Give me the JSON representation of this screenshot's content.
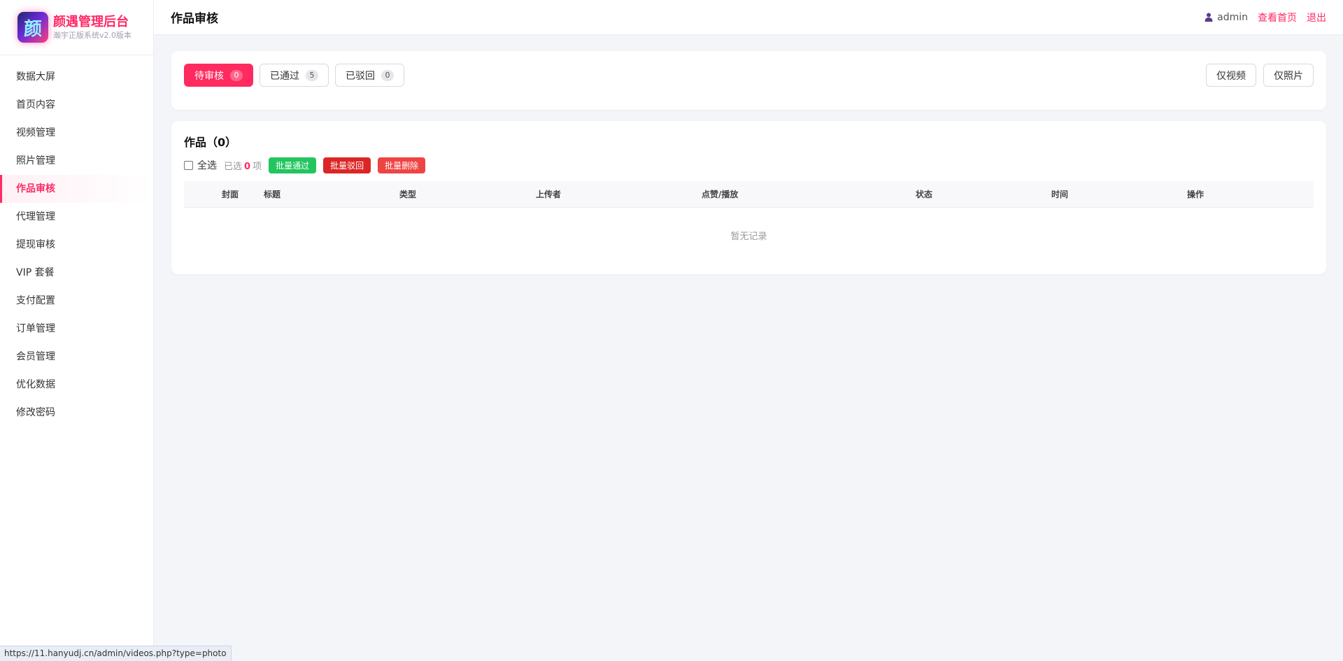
{
  "brand": {
    "logo_char": "颜",
    "title": "颜遇管理后台",
    "subtitle": "瀚宇正版系统v2.0版本"
  },
  "sidebar": {
    "items": [
      {
        "label": "数据大屏"
      },
      {
        "label": "首页内容"
      },
      {
        "label": "视频管理"
      },
      {
        "label": "照片管理"
      },
      {
        "label": "作品审核",
        "active": true
      },
      {
        "label": "代理管理"
      },
      {
        "label": "提现审核"
      },
      {
        "label": "VIP 套餐"
      },
      {
        "label": "支付配置"
      },
      {
        "label": "订单管理"
      },
      {
        "label": "会员管理"
      },
      {
        "label": "优化数据"
      },
      {
        "label": "修改密码"
      }
    ]
  },
  "header": {
    "title": "作品审核",
    "user": "admin",
    "view_home": "查看首页",
    "logout": "退出"
  },
  "filter": {
    "tabs": [
      {
        "label": "待审核",
        "count": "0",
        "active": true
      },
      {
        "label": "已通过",
        "count": "5"
      },
      {
        "label": "已驳回",
        "count": "0"
      }
    ],
    "video_only": "仅视频",
    "photo_only": "仅照片"
  },
  "list": {
    "title": "作品（0）",
    "select_all": "全选",
    "selected_prefix": "已选",
    "selected_count": "0",
    "selected_suffix": "项",
    "batch_approve": "批量通过",
    "batch_reject": "批量驳回",
    "batch_delete": "批量删除",
    "columns": [
      "封面",
      "标题",
      "类型",
      "上传者",
      "点赞/播放",
      "状态",
      "时间",
      "操作"
    ],
    "empty_text": "暂无记录"
  },
  "statusbar": {
    "url": "https://11.hanyudj.cn/admin/videos.php?type=photo"
  },
  "colors": {
    "accent": "#ff2a66",
    "approve": "#22c55e",
    "reject": "#dc2626",
    "delete": "#ef4444"
  }
}
